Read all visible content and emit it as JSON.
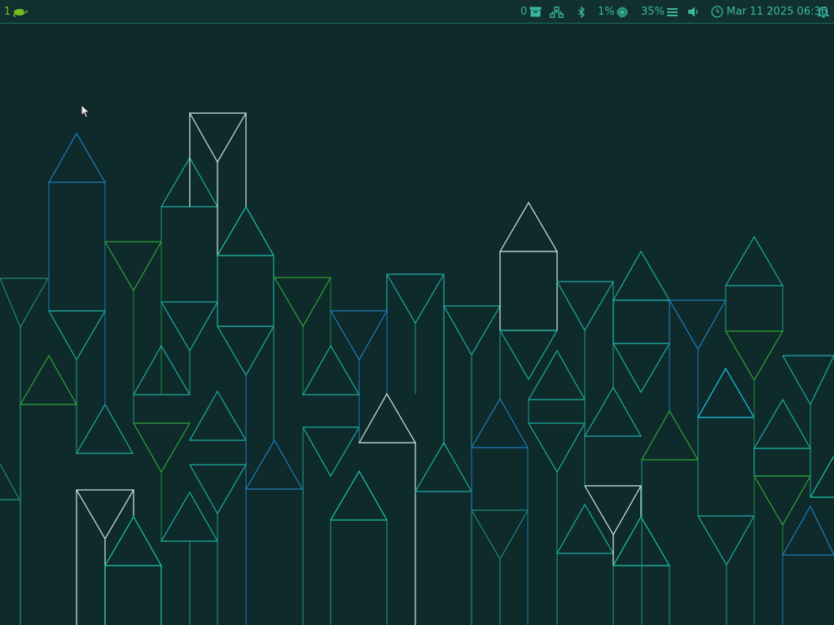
{
  "topbar": {
    "workspace": {
      "number": "1",
      "icon": "opensuse-chameleon-icon"
    },
    "tray": {
      "archive": {
        "count": "0",
        "icon": "archive-box-icon"
      },
      "network": {
        "icon": "network-icon"
      },
      "bluetooth": {
        "icon": "bluetooth-icon"
      },
      "cpu": {
        "value": "1%",
        "icon": "cpu-chip-icon"
      },
      "memory": {
        "value": "35%",
        "icon": "memory-bars-icon"
      },
      "volume": {
        "icon": "speaker-icon"
      },
      "clock": {
        "text": "Mar 11 2025 06:36",
        "icon": "clock-icon"
      },
      "notifications": {
        "icon": "bell-icon"
      }
    }
  },
  "theme": {
    "background": "#0e2a2b",
    "bar_background": "#11302f",
    "accent": "#3ab8a0",
    "chameleon": "#73ba25"
  },
  "desktop": {
    "wallpaper": "geometric-triangle-towers"
  }
}
